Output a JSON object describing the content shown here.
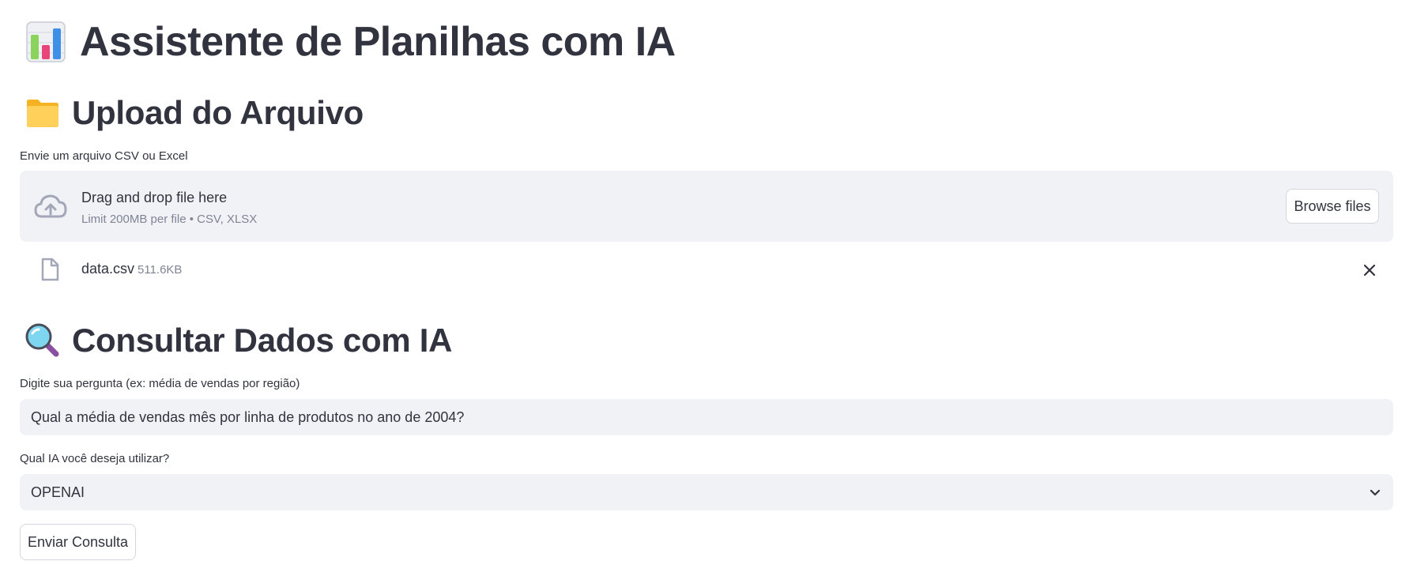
{
  "header": {
    "title": "Assistente de Planilhas com IA",
    "title_icon": "bar-chart-icon"
  },
  "upload": {
    "heading": "Upload do Arquivo",
    "heading_icon": "folder-icon",
    "label": "Envie um arquivo CSV ou Excel",
    "dropzone_text": "Drag and drop file here",
    "dropzone_limit": "Limit 200MB per file • CSV, XLSX",
    "browse_label": "Browse files",
    "file": {
      "name": "data.csv",
      "size": "511.6KB"
    }
  },
  "query": {
    "heading": "Consultar Dados com IA",
    "heading_icon": "magnifier-icon",
    "question_label": "Digite sua pergunta (ex: média de vendas por região)",
    "question_value": "Qual a média de vendas mês por linha de produtos no ano de 2004?",
    "ai_label": "Qual IA você deseja utilizar?",
    "ai_selected": "OPENAI",
    "submit_label": "Enviar Consulta"
  },
  "colors": {
    "text": "#31333f",
    "muted": "#808495",
    "input_bg": "#f0f2f6",
    "border": "#d5d7de"
  }
}
